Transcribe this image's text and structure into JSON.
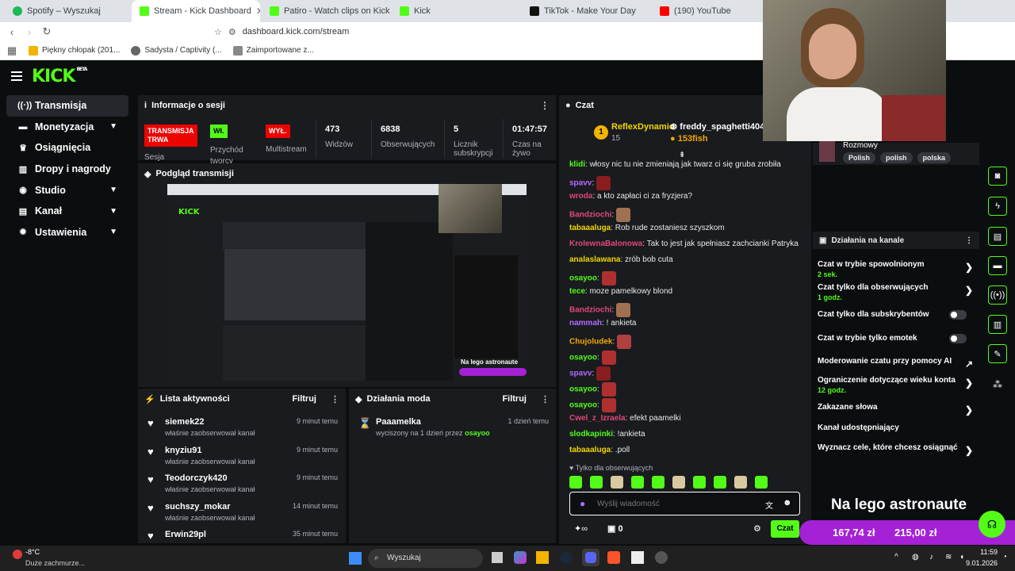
{
  "browser": {
    "tabs": [
      {
        "label": "Spotify – Wyszukaj",
        "color": "#1db954"
      },
      {
        "label": "Stream - Kick Dashboard",
        "color": "#53fc18",
        "active": true
      },
      {
        "label": "Patiro - Watch clips on Kick",
        "color": "#53fc18"
      },
      {
        "label": "Kick",
        "color": "#53fc18"
      },
      {
        "label": "TikTok - Make Your Day",
        "color": "#111111"
      },
      {
        "label": "(190) YouTube",
        "color": "#ff0000"
      }
    ],
    "url": "dashboard.kick.com/stream",
    "bookmarks": [
      "Piękny chłopak (201...",
      "Sadysta / Captivity (...",
      "Zaimportowane z..."
    ]
  },
  "kick": {
    "logo": "KICK",
    "beta": "BETA"
  },
  "sidebar": {
    "items": [
      {
        "label": "Transmisja",
        "icon": "broadcast-icon",
        "active": true
      },
      {
        "label": "Monetyzacja",
        "icon": "money-icon"
      },
      {
        "label": "Osiągnięcia",
        "icon": "trophy-icon"
      },
      {
        "label": "Dropy i nagrody",
        "icon": "drops-icon"
      },
      {
        "label": "Studio",
        "icon": "studio-icon"
      },
      {
        "label": "Kanał",
        "icon": "channel-icon"
      },
      {
        "label": "Ustawienia",
        "icon": "settings-icon"
      }
    ]
  },
  "session": {
    "title": "Informacje o sesji",
    "live_badge_1": "TRANSMISJA",
    "live_badge_2": "TRWA",
    "live_sub": "Sesja",
    "on_badge": "Wł.",
    "on_label": "Przychód",
    "on_sub": "tworcy",
    "off_badge": "WYŁ.",
    "off_label": "Multistream",
    "viewers": "473",
    "viewers_label": "Widzów",
    "followers": "6838",
    "followers_label": "Obserwujących",
    "subs": "5",
    "subs_label": "Licznik",
    "subs_label2": "subskrypcji",
    "time": "01:47:57",
    "time_label": "Czas na",
    "time_label2": "żywo"
  },
  "preview": {
    "title": "Podgląd transmisji"
  },
  "activity": {
    "title": "Lista aktywności",
    "filter": "Filtruj",
    "items": [
      {
        "name": "siemek22",
        "action": "właśnie zaobserwował kanał",
        "time": "9 minut temu"
      },
      {
        "name": "knyziu91",
        "action": "właśnie zaobserwował kanał",
        "time": "9 minut temu"
      },
      {
        "name": "Teodorczyk420",
        "action": "właśnie zaobserwował kanał",
        "time": "9 minut temu"
      },
      {
        "name": "suchszy_mokar",
        "action": "właśnie zaobserwował kanał",
        "time": "14 minut temu"
      },
      {
        "name": "Erwin29pl",
        "action": "",
        "time": "35 minut temu"
      }
    ]
  },
  "mods": {
    "title": "Działania moda",
    "filter": "Filtruj",
    "items": [
      {
        "name": "Paaamelka",
        "action": "wyciszony na 1 dzień przez",
        "by": "osayoo",
        "time": "1 dzień temu"
      }
    ]
  },
  "chat": {
    "title": "Czat",
    "pinned": [
      {
        "rank": "1",
        "name": "ReflexDynamic",
        "amount": "15"
      },
      {
        "name": "freddy_spaghetti404",
        "amount": "153fish"
      }
    ],
    "messages": [
      {
        "user": "klidi",
        "color": "#53fc18",
        "text": ": włosy nic tu nie zmieniają jak twarz ci się gruba zrobiła"
      },
      {
        "user": "spavv",
        "color": "#b36bff",
        "text": ":"
      },
      {
        "user": "wroda",
        "color": "#e0487a",
        "text": ": a kto zapłaci ci za fryzjera?"
      },
      {
        "user": "Bandziochi",
        "color": "#e0487a",
        "text": ":"
      },
      {
        "user": "tabaaaluga",
        "color": "#f2d600",
        "text": ": Rob rude zostaniesz szyszkom"
      },
      {
        "user": "KrolewnaBalonowa",
        "color": "#e0487a",
        "text": ": Tak to jest jak spełniasz zachcianki Patryka"
      },
      {
        "user": "analaslawana",
        "color": "#f2d600",
        "text": ": zrób bob cuta"
      },
      {
        "user": "osayoo",
        "color": "#53fc18",
        "text": ":"
      },
      {
        "user": "tece",
        "color": "#53fc18",
        "text": ": moze pamelkowy blond"
      },
      {
        "user": "Bandziochi",
        "color": "#e0487a",
        "text": ":"
      },
      {
        "user": "nammah",
        "color": "#b36bff",
        "text": ": ! ankieta"
      },
      {
        "user": "Chujoludek",
        "color": "#f2a600",
        "text": ":"
      },
      {
        "user": "osayoo",
        "color": "#53fc18",
        "text": ":"
      },
      {
        "user": "spavv",
        "color": "#b36bff",
        "text": ":"
      },
      {
        "user": "osayoo",
        "color": "#53fc18",
        "text": ":"
      },
      {
        "user": "osayoo",
        "color": "#53fc18",
        "text": ":"
      },
      {
        "user": "Cwel_z_Izraela",
        "color": "#e0487a",
        "text": ": efekt paamelki"
      },
      {
        "user": "slodkapinki",
        "color": "#53fc18",
        "text": ": !ankieta"
      },
      {
        "user": "tabaaaluga",
        "color": "#f2d600",
        "text": ": .poll"
      }
    ],
    "followers_only": "Tylko dla obserwujących",
    "placeholder": "Wyślij wiadomość",
    "counter": "0",
    "send": "Czat"
  },
  "rightpanel": {
    "stream_tag": "Rozmowy",
    "tags": [
      "Polish",
      "polish",
      "polska"
    ],
    "title": "Działania na kanale",
    "items": [
      {
        "label": "Czat w trybie spowolnionym",
        "value": "2 sek.",
        "type": "arrow"
      },
      {
        "label": "Czat tylko dla obserwujących",
        "value": "1 godz.",
        "type": "arrow"
      },
      {
        "label": "Czat tylko dla subskrybentów",
        "value": "",
        "type": "toggle"
      },
      {
        "label": "Czat w trybie tylko emotek",
        "value": "",
        "type": "toggle"
      },
      {
        "label": "Moderowanie czatu przy pomocy AI",
        "value": "",
        "type": "external"
      },
      {
        "label": "Ograniczenie dotyczące wieku konta",
        "value": "12 godz.",
        "type": "arrow"
      },
      {
        "label": "Zakazane słowa",
        "value": "",
        "type": "arrow"
      },
      {
        "label": "Kanał udostępniający",
        "value": "",
        "type": "none"
      },
      {
        "label": "Wyznacz cele, które chcesz osiągnąć",
        "value": "",
        "type": "arrow"
      }
    ]
  },
  "overlay": {
    "title": "Na lego astronaute",
    "amount1": "167,74 zł",
    "amount2": "215,00 zł"
  },
  "taskbar": {
    "temp": "-8°C",
    "weather": "Duże zachmurze...",
    "search": "Wyszukaj",
    "time": "11:59",
    "date": "9.01.2026"
  },
  "colors": {
    "accent": "#53fc18",
    "live": "#eb0400",
    "panel": "#191b1f",
    "bg": "#0b0e0f"
  }
}
